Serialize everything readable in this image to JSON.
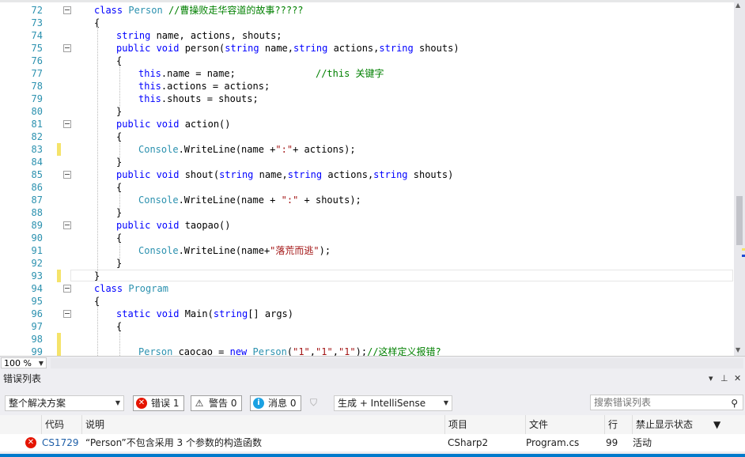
{
  "editor": {
    "lines": [
      {
        "n": "72",
        "parts": [
          [
            "k",
            "class "
          ],
          [
            "t",
            "Person"
          ],
          [
            "c",
            " //曹操败走华容道的故事?????"
          ]
        ]
      },
      {
        "n": "73",
        "parts": [
          [
            "p",
            "{"
          ]
        ]
      },
      {
        "n": "74",
        "parts": [
          [
            "k",
            "string"
          ],
          [
            "p",
            " name, actions, shouts;"
          ]
        ]
      },
      {
        "n": "75",
        "parts": [
          [
            "k",
            "public void"
          ],
          [
            "p",
            " person("
          ],
          [
            "k",
            "string"
          ],
          [
            "p",
            " name,"
          ],
          [
            "k",
            "string"
          ],
          [
            "p",
            " actions,"
          ],
          [
            "k",
            "string"
          ],
          [
            "p",
            " shouts)"
          ]
        ]
      },
      {
        "n": "76",
        "parts": [
          [
            "p",
            "{"
          ]
        ]
      },
      {
        "n": "77",
        "parts": [
          [
            "k",
            "this"
          ],
          [
            "p",
            ".name = name;"
          ],
          [
            "c",
            "              //this 关键字"
          ]
        ]
      },
      {
        "n": "78",
        "parts": [
          [
            "k",
            "this"
          ],
          [
            "p",
            ".actions = actions;"
          ]
        ]
      },
      {
        "n": "79",
        "parts": [
          [
            "k",
            "this"
          ],
          [
            "p",
            ".shouts = shouts;"
          ]
        ]
      },
      {
        "n": "80",
        "parts": [
          [
            "p",
            "}"
          ]
        ]
      },
      {
        "n": "81",
        "parts": [
          [
            "k",
            "public void"
          ],
          [
            "p",
            " action()"
          ]
        ]
      },
      {
        "n": "82",
        "parts": [
          [
            "p",
            "{"
          ]
        ]
      },
      {
        "n": "83",
        "parts": [
          [
            "t",
            "Console"
          ],
          [
            "p",
            ".WriteLine(name +"
          ],
          [
            "s",
            "\":\""
          ],
          [
            "p",
            "+ actions);"
          ]
        ]
      },
      {
        "n": "84",
        "parts": [
          [
            "p",
            "}"
          ]
        ]
      },
      {
        "n": "85",
        "parts": [
          [
            "k",
            "public void"
          ],
          [
            "p",
            " shout("
          ],
          [
            "k",
            "string"
          ],
          [
            "p",
            " name,"
          ],
          [
            "k",
            "string"
          ],
          [
            "p",
            " actions,"
          ],
          [
            "k",
            "string"
          ],
          [
            "p",
            " shouts)"
          ]
        ]
      },
      {
        "n": "86",
        "parts": [
          [
            "p",
            "{"
          ]
        ]
      },
      {
        "n": "87",
        "parts": [
          [
            "t",
            "Console"
          ],
          [
            "p",
            ".WriteLine(name + "
          ],
          [
            "s",
            "\":\""
          ],
          [
            "p",
            " + shouts);"
          ]
        ]
      },
      {
        "n": "88",
        "parts": [
          [
            "p",
            "}"
          ]
        ]
      },
      {
        "n": "89",
        "parts": [
          [
            "k",
            "public void"
          ],
          [
            "p",
            " taopao()"
          ]
        ]
      },
      {
        "n": "90",
        "parts": [
          [
            "p",
            "{"
          ]
        ]
      },
      {
        "n": "91",
        "parts": [
          [
            "t",
            "Console"
          ],
          [
            "p",
            ".WriteLine(name+"
          ],
          [
            "s",
            "\"落荒而逃\""
          ],
          [
            "p",
            ");"
          ]
        ]
      },
      {
        "n": "92",
        "parts": [
          [
            "p",
            "}"
          ]
        ]
      },
      {
        "n": "93",
        "parts": [
          [
            "p",
            "}"
          ]
        ]
      },
      {
        "n": "94",
        "parts": [
          [
            "k",
            "class "
          ],
          [
            "t",
            "Program"
          ]
        ]
      },
      {
        "n": "95",
        "parts": [
          [
            "p",
            "{"
          ]
        ]
      },
      {
        "n": "96",
        "parts": [
          [
            "k",
            "static void"
          ],
          [
            "p",
            " Main("
          ],
          [
            "k",
            "string"
          ],
          [
            "p",
            "[] args)"
          ]
        ]
      },
      {
        "n": "97",
        "parts": [
          [
            "p",
            "{"
          ]
        ]
      },
      {
        "n": "98",
        "parts": [
          [
            "p",
            ""
          ]
        ]
      },
      {
        "n": "99",
        "parts": [
          [
            "t",
            "Person"
          ],
          [
            "p",
            " caocao = "
          ],
          [
            "k",
            "new "
          ],
          [
            "t",
            "Person"
          ],
          [
            "p",
            "("
          ],
          [
            "s",
            "\"1\""
          ],
          [
            "p",
            ","
          ],
          [
            "s",
            "\"1\""
          ],
          [
            "p",
            ","
          ],
          [
            "s",
            "\"1\""
          ],
          [
            "p",
            ");"
          ],
          [
            "c",
            "//这样定义报错?"
          ]
        ]
      }
    ],
    "zoom": "100 %"
  },
  "error_list": {
    "title": "错误列表",
    "scope_select": "整个解决方案",
    "errors_btn": "错误 1",
    "warnings_btn": "警告 0",
    "messages_btn": "消息 0",
    "build_select": "生成 + IntelliSense",
    "search_placeholder": "搜索错误列表",
    "columns": {
      "code": "代码",
      "description": "说明",
      "project": "项目",
      "file": "文件",
      "line": "行",
      "suppression": "禁止显示状态"
    },
    "rows": [
      {
        "code": "CS1729",
        "description": "“Person”不包含采用 3 个参数的构造函数",
        "project": "CSharp2",
        "file": "Program.cs",
        "line": "99",
        "suppression": "活动"
      }
    ]
  },
  "colors": {
    "keyword": "#0000ff",
    "type": "#2b91af",
    "string": "#a31515",
    "comment": "#008000",
    "error": "#e51400",
    "warning": "#ffcc00",
    "info": "#1ba1e2",
    "accent": "#007acc"
  }
}
